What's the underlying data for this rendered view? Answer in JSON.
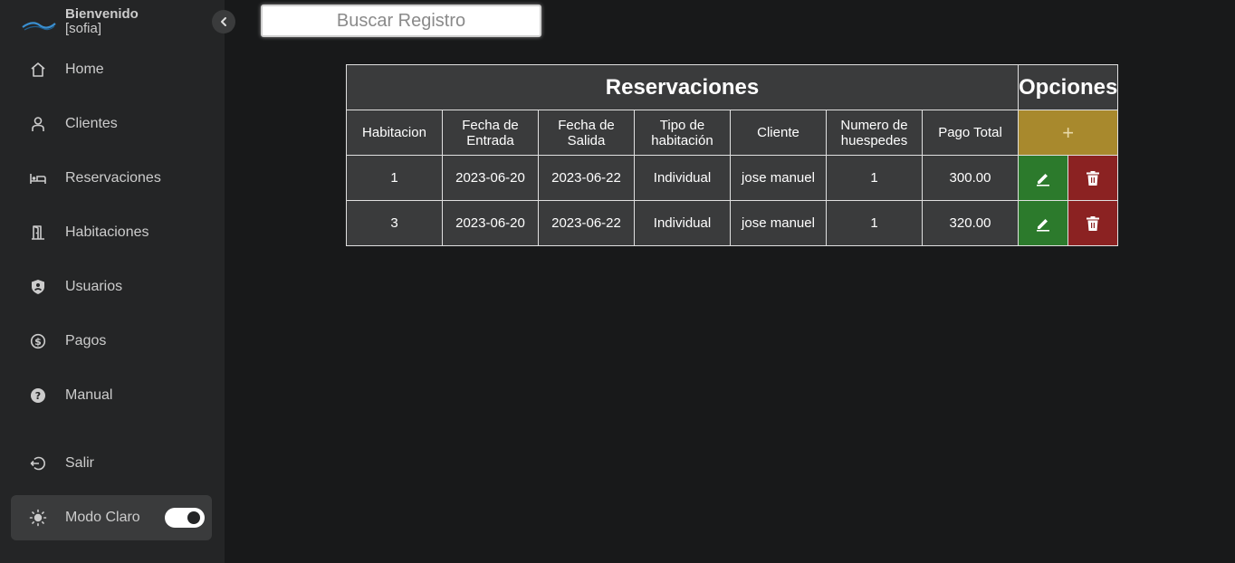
{
  "sidebar": {
    "brand": {
      "title": "Bienvenido",
      "user": "[sofia]"
    },
    "items": [
      {
        "label": "Home",
        "icon": "home-icon"
      },
      {
        "label": "Clientes",
        "icon": "user-icon"
      },
      {
        "label": "Reservaciones",
        "icon": "bed-icon"
      },
      {
        "label": "Habitaciones",
        "icon": "door-icon"
      },
      {
        "label": "Usuarios",
        "icon": "shield-user-icon"
      },
      {
        "label": "Pagos",
        "icon": "dollar-coin-icon"
      },
      {
        "label": "Manual",
        "icon": "help-circle-icon"
      }
    ],
    "logout": {
      "label": "Salir",
      "icon": "logout-icon"
    },
    "mode": {
      "label": "Modo Claro",
      "icon": "sun-icon",
      "enabled": true
    }
  },
  "search": {
    "placeholder": "Buscar Registro",
    "value": ""
  },
  "table": {
    "title": "Reservaciones",
    "options_title": "Opciones",
    "add_label": "+",
    "headers": [
      {
        "line1": "Habitacion",
        "line2": ""
      },
      {
        "line1": "Fecha de",
        "line2": "Entrada"
      },
      {
        "line1": "Fecha de",
        "line2": "Salida"
      },
      {
        "line1": "Tipo de",
        "line2": "habitación"
      },
      {
        "line1": "Cliente",
        "line2": ""
      },
      {
        "line1": "Numero de",
        "line2": "huespedes"
      },
      {
        "line1": "Pago Total",
        "line2": ""
      }
    ],
    "rows": [
      [
        "1",
        "2023-06-20",
        "2023-06-22",
        "Individual",
        "jose manuel",
        "1",
        "300.00"
      ],
      [
        "3",
        "2023-06-20",
        "2023-06-22",
        "Individual",
        "jose manuel",
        "1",
        "320.00"
      ]
    ]
  },
  "colors": {
    "background": "#18191a",
    "sidebar": "#242526",
    "table_cell": "#3a3b3c",
    "add": "#a8892d",
    "edit": "#2c7a2c",
    "delete": "#8b2222"
  }
}
